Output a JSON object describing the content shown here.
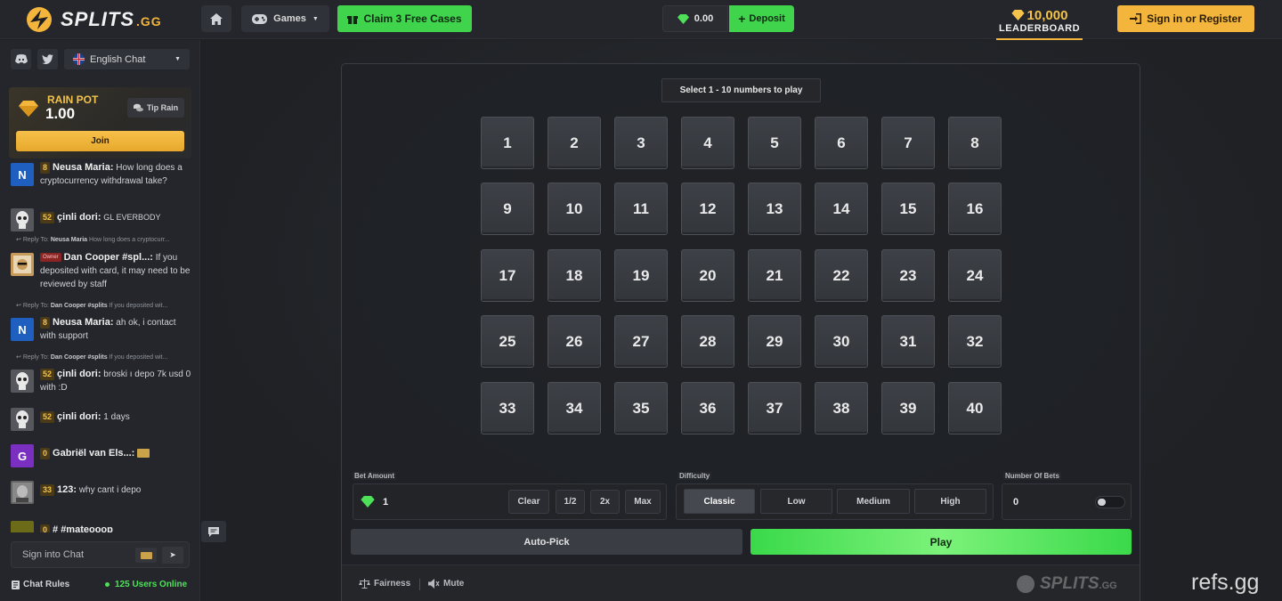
{
  "header": {
    "logo_text": "SPLITS",
    "logo_suffix": ".GG",
    "games_label": "Games",
    "claim_label": "Claim 3 Free Cases",
    "balance": "0.00",
    "deposit_label": "Deposit",
    "leaderboard_amount": "10,000",
    "leaderboard_label": "LEADERBOARD",
    "signin_label": "Sign in or Register"
  },
  "sidebar": {
    "language": "English Chat",
    "rain": {
      "title": "RAIN POT",
      "amount": "1.00",
      "tip_label": "Tip Rain",
      "join_label": "Join"
    },
    "messages": [
      {
        "level": "8",
        "user": "Neusa Maria:",
        "text": "How long does a cryptocurrency withdrawal take?",
        "avatar": "N",
        "color": "#1f5fbf"
      },
      {
        "level": "52",
        "user": "çinli dori:",
        "text": "GL EVERBODY",
        "avatar": "",
        "color": "#555"
      },
      {
        "owner": "Owner",
        "user": "Dan Cooper #spl...:",
        "text": "If you deposited with card, it may need to be reviewed by staff",
        "avatar": "",
        "color": "#c59a5a"
      },
      {
        "level": "8",
        "user": "Neusa Maria:",
        "text": "ah ok, i contact with support",
        "avatar": "N",
        "color": "#1f5fbf"
      },
      {
        "level": "52",
        "user": "çinli dori:",
        "text": "broski ı depo 7k usd 0 with :D",
        "avatar": "",
        "color": "#555"
      },
      {
        "level": "52",
        "user": "çinli dori:",
        "text": "1 days",
        "avatar": "",
        "color": "#555"
      },
      {
        "level": "0",
        "user": "Gabriël van Els...:",
        "text": "",
        "avatar": "G",
        "color": "#7b2fc0"
      },
      {
        "level": "33",
        "user": "123:",
        "text": "why cant i depo",
        "avatar": "",
        "color": "#666"
      },
      {
        "level": "0",
        "user": "# #mateooop",
        "text": "",
        "avatar": "",
        "color": "#6b6b18"
      }
    ],
    "replies": [
      {
        "prefix": "Reply To:",
        "user": "Neusa Maria",
        "text": "How long does a cryptocurr..."
      },
      {
        "prefix": "Reply To:",
        "user": "Dan Cooper #splits",
        "text": "If you deposited wit..."
      },
      {
        "prefix": "Reply To:",
        "user": "Dan Cooper #splits",
        "text": "If you deposited wit..."
      }
    ],
    "chat_placeholder": "Sign into Chat",
    "chat_rules": "Chat Rules",
    "online": "125 Users Online"
  },
  "game": {
    "hint": "Select 1 - 10 numbers to play",
    "tiles": [
      "1",
      "2",
      "3",
      "4",
      "5",
      "6",
      "7",
      "8",
      "9",
      "10",
      "11",
      "12",
      "13",
      "14",
      "15",
      "16",
      "17",
      "18",
      "19",
      "20",
      "21",
      "22",
      "23",
      "24",
      "25",
      "26",
      "27",
      "28",
      "29",
      "30",
      "31",
      "32",
      "33",
      "34",
      "35",
      "36",
      "37",
      "38",
      "39",
      "40"
    ],
    "bet_amount_label": "Bet Amount",
    "bet_value": "1",
    "bet_buttons": [
      "Clear",
      "1/2",
      "2x",
      "Max"
    ],
    "difficulty_label": "Difficulty",
    "difficulties": [
      "Classic",
      "Low",
      "Medium",
      "High"
    ],
    "active_difficulty": "Classic",
    "num_bets_label": "Number Of Bets",
    "num_bets_value": "0",
    "autopick_label": "Auto-Pick",
    "play_label": "Play",
    "fairness_label": "Fairness",
    "mute_label": "Mute",
    "footer_logo": "SPLITS",
    "footer_logo_suffix": ".GG"
  },
  "watermark": "refs.gg",
  "colors": {
    "accent_green": "#3fd44b",
    "accent_gold": "#f3b53b"
  }
}
